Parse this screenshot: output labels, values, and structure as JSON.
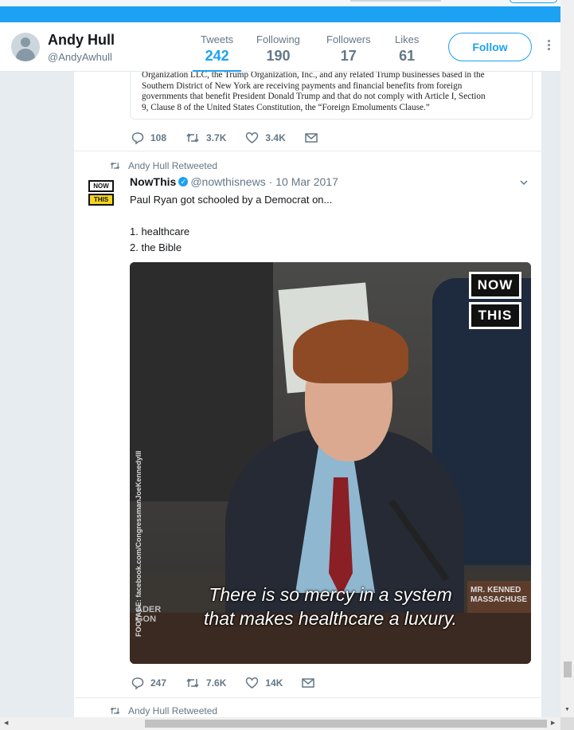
{
  "profile": {
    "name": "Andy Hull",
    "handle": "@AndyAwhull",
    "follow_label": "Follow",
    "stats": [
      {
        "label": "Tweets",
        "value": "242"
      },
      {
        "label": "Following",
        "value": "190"
      },
      {
        "label": "Followers",
        "value": "17"
      },
      {
        "label": "Likes",
        "value": "61"
      }
    ]
  },
  "tweet1": {
    "document_text": [
      "Organization LLC, the Trump Organization, Inc., and any related Trump businesses based in the",
      "Southern District of New York are receiving payments and financial benefits from foreign",
      "governments that benefit President Donald Trump and that do not comply with Article I, Section",
      "9, Clause 8 of the United States Constitution, the “Foreign Emoluments Clause.”"
    ],
    "replies": "108",
    "retweets": "3.7K",
    "likes": "3.4K"
  },
  "tweet2": {
    "retweet_context": "Andy Hull Retweeted",
    "author_logo": [
      "NOW",
      "THIS"
    ],
    "author_name": "NowThis",
    "author_handle": "@nowthisnews",
    "date": "· 10 Mar 2017",
    "text_lines": [
      "Paul Ryan got schooled by a Democrat on...",
      "",
      "1. healthcare",
      "2. the Bible"
    ],
    "media": {
      "badge": [
        "NOW",
        "THIS"
      ],
      "footage_credit": "FOOTAGE: facebook.com/CongressmanJoeKennedyIII",
      "nameplate": [
        "MR. KENNED",
        "MASSACHUSE"
      ],
      "nameplate_left": [
        "ADER",
        "GON"
      ],
      "caption_lines": [
        "There is so mercy in a system",
        "that makes healthcare a luxury."
      ]
    },
    "replies": "247",
    "retweets": "7.6K",
    "likes": "14K"
  },
  "tweet3": {
    "retweet_context": "Andy Hull Retweeted"
  },
  "colors": {
    "accent": "#1da1f2",
    "muted": "#657786",
    "background": "#e6ecf0"
  },
  "icons": [
    "reply-icon",
    "retweet-icon",
    "like-icon",
    "message-icon",
    "verified-icon",
    "chevron-down-icon",
    "more-icon"
  ]
}
